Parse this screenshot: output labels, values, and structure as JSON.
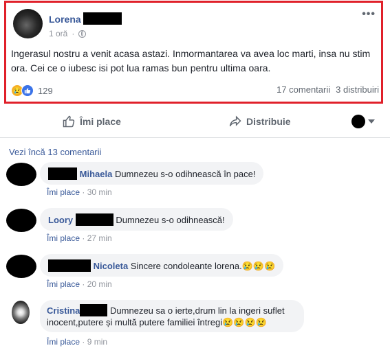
{
  "post": {
    "author": "Lorena",
    "time": "1 oră",
    "more": "•••",
    "text": "Ingerasul nostru a venit acasa astazi. Inmormantarea va avea loc marti, insa nu stim ora. Cei ce o iubesc isi pot lua ramas bun pentru ultima oara.",
    "reaction_count": "129",
    "comments_count": "17 comentarii",
    "shares_count": "3 distribuiri"
  },
  "actions": {
    "like": "Îmi place",
    "share": "Distribuie"
  },
  "more_comments": "Vezi încă 13 comentarii",
  "comments": [
    {
      "name": "Mihaela",
      "text": "Dumnezeu s-o odihnească în pace!",
      "like": "Îmi place",
      "time": "30 min"
    },
    {
      "name": "Loory",
      "text": "Dumnezeu s-o odihnească!",
      "like": "Îmi place",
      "time": "27 min"
    },
    {
      "name": "Nicoleta",
      "text": "Sincere condoleante lorena.",
      "emoji": "😢😢😢",
      "like": "Îmi place",
      "time": "20 min"
    },
    {
      "name": "Cristina",
      "text": "Dumnezeu sa o ierte,drum lin la ingeri suflet inocent,putere și multă putere familiei întregi",
      "emoji": "😢😢😢😢",
      "like": "Îmi place",
      "time": "9 min"
    }
  ],
  "icons": {
    "sad": "sad-reaction-icon",
    "like": "like-reaction-icon",
    "globe": "globe-icon",
    "thumb": "thumbs-up-icon",
    "share": "share-arrow-icon"
  },
  "colors": {
    "highlight_border": "#e0202a",
    "link": "#385898",
    "like_blue": "#3b73e8"
  }
}
